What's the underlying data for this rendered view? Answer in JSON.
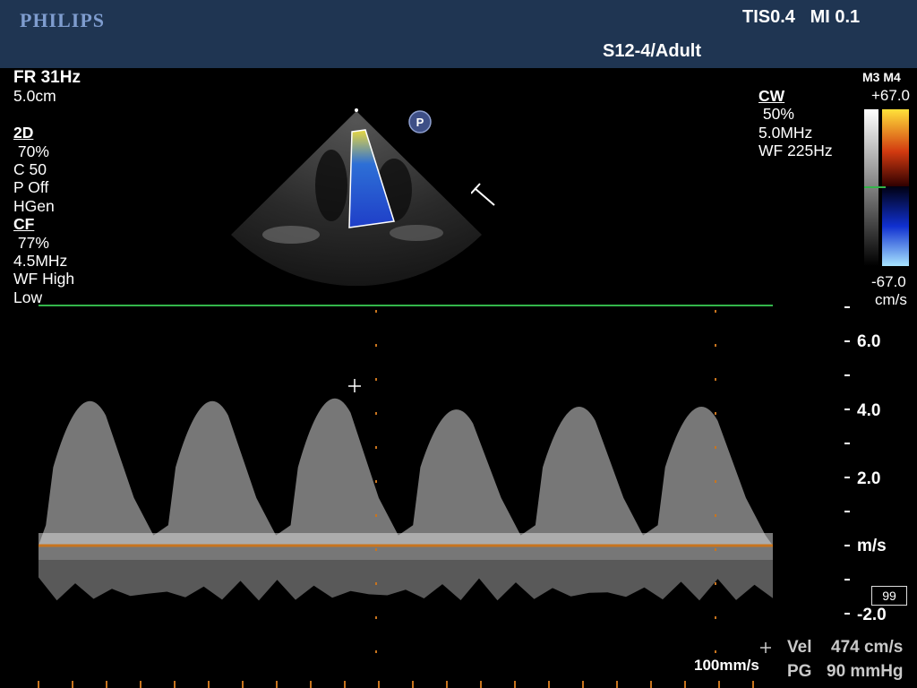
{
  "header": {
    "brand": "PHILIPS",
    "tis_mi": "TIS0.4   MI 0.1",
    "probe_preset": "S12-4/Adult"
  },
  "left_panel": {
    "fr": "FR 31Hz",
    "depth": "5.0cm",
    "mode_2d": {
      "title": "2D",
      "gain": " 70%",
      "compression": "C 50",
      "persistence": "P Off",
      "harmonics": "HGen"
    },
    "mode_cf": {
      "title": "CF",
      "gain": " 77%",
      "freq": "4.5MHz",
      "wall_filter": "WF High",
      "flow": "Low"
    }
  },
  "right_panel": {
    "title": "CW",
    "gain": " 50%",
    "freq": "5.0MHz",
    "wall_filter": "WF 225Hz"
  },
  "color_bar": {
    "maps": "M3 M4",
    "top_value": "+67.0",
    "bottom_value": "-67.0",
    "unit": "cm/s"
  },
  "markers": {
    "p_marker": "P"
  },
  "doppler_scale": {
    "labels": [
      "6.0",
      "4.0",
      "2.0",
      "m/s",
      "-2.0"
    ]
  },
  "measurements": {
    "vel_label": "Vel",
    "vel_value": "474 cm/s",
    "pg_label": "PG",
    "pg_value": "90 mmHg"
  },
  "frame_counter": "99",
  "sweep_speed": "100mm/s",
  "spectrum": {
    "peak_velocity_m_s": [
      4.9,
      4.9,
      5.0,
      4.6,
      4.7,
      4.7
    ],
    "reverse_velocity_m_s": -1.7,
    "scale_max_m_s": 7.0,
    "scale_min_m_s": -3.0
  },
  "colors": {
    "header_bg": "#1f3552",
    "brand": "#7f9dcf",
    "baseline": "#c8741e",
    "top_line": "#33b54a"
  }
}
